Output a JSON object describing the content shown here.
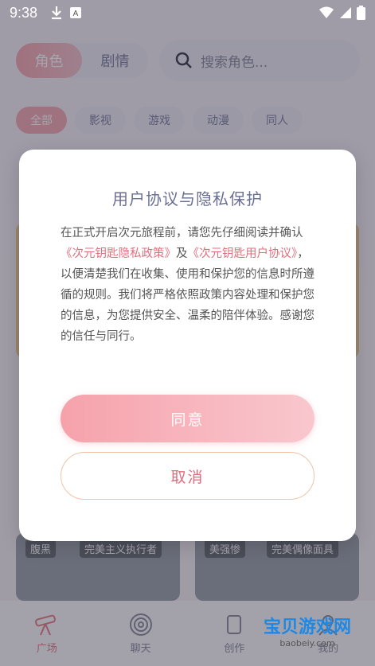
{
  "status_bar": {
    "time": "9:38"
  },
  "background": {
    "segment": {
      "role_label": "角色",
      "story_label": "剧情"
    },
    "search_placeholder": "搜索角色...",
    "chips": [
      "全部",
      "影视",
      "游戏",
      "动漫",
      "同人"
    ],
    "cards": [
      {
        "tag1": "腹黑",
        "tag2": "完美主义执行者"
      },
      {
        "tag1": "美强惨",
        "tag2": "完美偶像面具"
      }
    ],
    "tabs": [
      {
        "label": "广场"
      },
      {
        "label": "聊天"
      },
      {
        "label": "创作"
      },
      {
        "label": "我的"
      }
    ],
    "watermark": {
      "title": "宝贝游戏网",
      "domain": "baobeiy.com"
    }
  },
  "dialog": {
    "title": "用户协议与隐私保护",
    "body_intro": "在正式开启次元旅程前，请您先仔细阅读并确认",
    "privacy_link": "《次元钥匙隐私政策》",
    "and": "及",
    "terms_link": "《次元钥匙用户协议》",
    "body_rest": "，以便清楚我们在收集、使用和保护您的信息时所遵循的规则。我们将严格依照政策内容处理和保护您的信息，为您提供安全、温柔的陪伴体验。感谢您的信任与同行。",
    "agree_label": "同意",
    "cancel_label": "取消"
  },
  "colors": {
    "accent_pink": "#f6a2ab",
    "link_pink": "#e36f7e",
    "title_indigo": "#6a6f94"
  }
}
